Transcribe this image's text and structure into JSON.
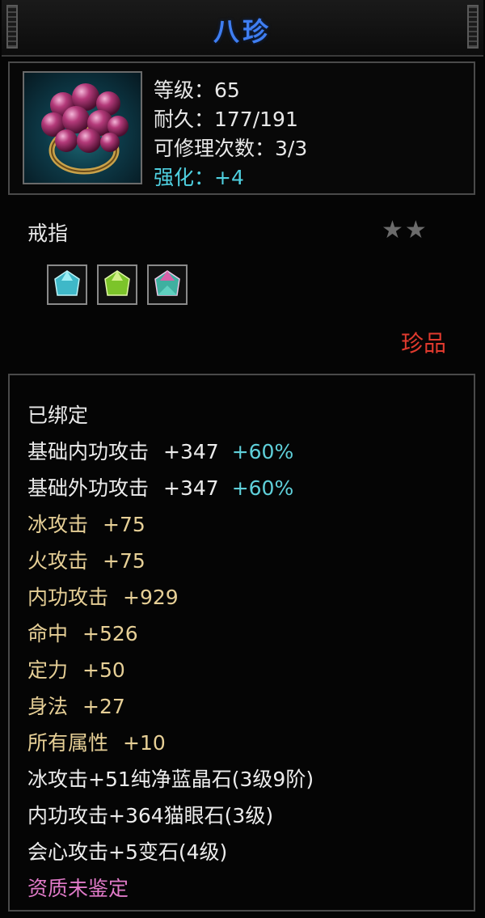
{
  "item": {
    "name": "八珍",
    "level": "等级：65",
    "durability": "耐久：177/191",
    "repairs": "可修理次数：3/3",
    "enhance": "强化：+4",
    "type": "戒指",
    "stars": "★★",
    "rarity": "珍品"
  },
  "gems": [
    "blue-gem-icon",
    "green-gem-icon",
    "multicolor-gem-icon"
  ],
  "attributes": {
    "bound": "已绑定",
    "base_inner": {
      "label": "基础内功攻击",
      "value": "+347",
      "bonus": "+60%"
    },
    "base_outer": {
      "label": "基础外功攻击",
      "value": "+347",
      "bonus": "+60%"
    },
    "ice": {
      "label": "冰攻击",
      "value": "+75"
    },
    "fire": {
      "label": "火攻击",
      "value": "+75"
    },
    "inner": {
      "label": "内功攻击",
      "value": "+929"
    },
    "hit": {
      "label": "命中",
      "value": "+526"
    },
    "focus": {
      "label": "定力",
      "value": "+50"
    },
    "agility": {
      "label": "身法",
      "value": "+27"
    },
    "all_stats": {
      "label": "所有属性",
      "value": "+10"
    },
    "gem1": "冰攻击+51纯净蓝晶石(3级9阶)",
    "gem2": "内功攻击+364猫眼石(3级)",
    "gem3": "会心攻击+5变石(4级)",
    "aptitude": "资质未鉴定"
  },
  "colors": {
    "title": "#3f7ef2",
    "enhance": "#4fd0e0",
    "rarity": "#e03a2e",
    "attribute": "#e6cf96",
    "bonus": "#5fd0da",
    "aptitude": "#e07ac8"
  }
}
